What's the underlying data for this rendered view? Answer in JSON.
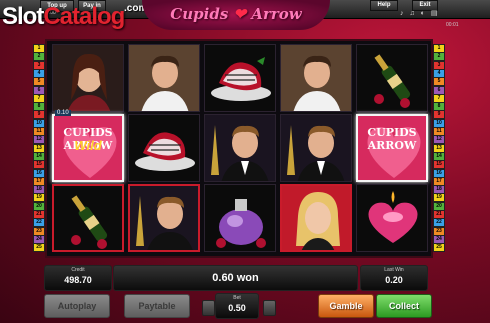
{
  "topbar": {
    "topup_label": "Top up",
    "payin_label": "Pay in",
    "balance_small": "0.00",
    "help_label": "Help",
    "exit_label": "Exit",
    "time": "00:01"
  },
  "logo": {
    "slot": "Slot",
    "catalog": "Catalog",
    "com": ".com"
  },
  "game": {
    "title": "Cupids",
    "title2": "Arrow"
  },
  "reels": {
    "win_badge": "0.10",
    "grid": [
      [
        "woman-portrait",
        "man-portrait",
        "strawberry-plate",
        "man-portrait",
        "champagne-bottle"
      ],
      [
        "cupids-arrow-wild",
        "strawberry-plate",
        "man-eiffel",
        "man-eiffel",
        "cupids-arrow-wild"
      ],
      [
        "champagne-bottle",
        "man-eiffel",
        "perfume-bottle",
        "woman-blonde",
        "heart-candle"
      ]
    ],
    "wild_text": "CUPIDS ARROW",
    "wild_overlay": "Wild"
  },
  "paylines_left": [
    "1",
    "2",
    "3",
    "4",
    "5",
    "6",
    "7",
    "8",
    "9",
    "10",
    "11",
    "12",
    "13",
    "14",
    "15",
    "16",
    "17",
    "18",
    "19",
    "20",
    "21",
    "22",
    "23",
    "24",
    "25",
    "26",
    "27",
    "28",
    "29",
    "30"
  ],
  "bottom": {
    "credit_label": "Credit",
    "credit_value": "498.70",
    "won_text": "0.60 won",
    "last_win_label": "Last Win",
    "last_win_value": "0.20",
    "bet_label": "Bet",
    "bet_value": "0.50",
    "autoplay": "Autoplay",
    "paytable": "Paytable",
    "gamble": "Gamble",
    "collect": "Collect"
  },
  "colors": {
    "accent_red": "#c91b2b",
    "gamble_orange": "#e07020",
    "collect_green": "#2c9a22"
  }
}
